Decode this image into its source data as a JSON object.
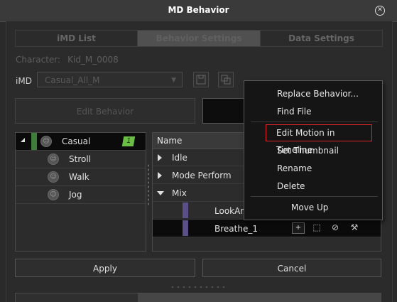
{
  "window": {
    "title": "MD Behavior"
  },
  "tabs": [
    {
      "label": "iMD List"
    },
    {
      "label": "Behavior Settings"
    },
    {
      "label": "Data Settings"
    }
  ],
  "character": {
    "label": "Character:",
    "value": "Kid_M_0008"
  },
  "imd": {
    "label": "iMD",
    "selected": "Casual_All_M"
  },
  "buttons": {
    "edit_behavior": "Edit Behavior",
    "apply": "Apply",
    "cancel": "Cancel"
  },
  "behavior_tree": {
    "group": {
      "label": "Casual",
      "count": "1"
    },
    "children": [
      {
        "label": "Stroll"
      },
      {
        "label": "Walk"
      },
      {
        "label": "Jog"
      }
    ]
  },
  "motion_list": {
    "header": "Name",
    "rows": [
      {
        "label": "Idle"
      },
      {
        "label": "Mode Perform"
      },
      {
        "label": "Mix"
      }
    ],
    "subrows": [
      {
        "label": "LookAro"
      },
      {
        "label": "Breathe_1"
      }
    ],
    "add_label": "+"
  },
  "context_menu": {
    "items": [
      {
        "label": "Replace Behavior..."
      },
      {
        "label": "Find File"
      },
      {
        "label": "Edit Motion in Timeline"
      },
      {
        "label": "Set Thumbnail"
      },
      {
        "label": "Rename"
      },
      {
        "label": "Delete"
      },
      {
        "label": "Move Up"
      }
    ]
  },
  "colors": {
    "group_accent": "#3f7d3a",
    "count_badge": "#6bbd45",
    "motion_accent": "#5a4f86",
    "menu_highlight_border": "#e0262a"
  },
  "icons": {
    "close": "close-icon",
    "avatar": "character-avatar-icon",
    "save": "save-icon",
    "duplicate": "duplicate-icon"
  }
}
